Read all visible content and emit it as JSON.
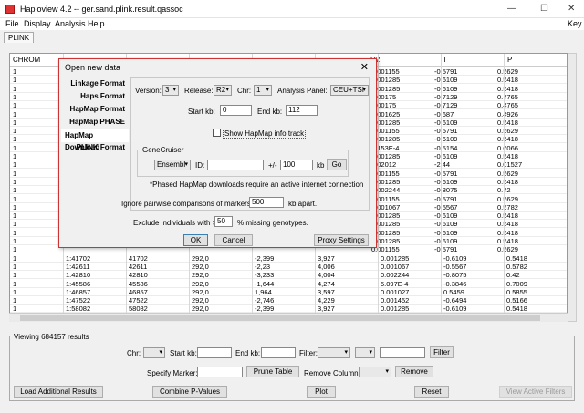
{
  "window": {
    "title": "Haploview 4.2 -- ger.sand.plink.result.qassoc",
    "controls": [
      "—",
      "☐",
      "✕"
    ]
  },
  "menu": [
    "File",
    "Display",
    "Analysis",
    "Help"
  ],
  "menu_right": "Key",
  "tab": "PLINK",
  "table": {
    "columns": [
      "CHROM",
      "",
      "",
      "",
      "",
      "R2",
      "T",
      "P"
    ],
    "rows": [
      [
        "1",
        "",
        "",
        "",
        "",
        "0.001155",
        "-0.5791",
        "0.5629"
      ],
      [
        "1",
        "",
        "",
        "",
        "",
        "0.001285",
        "-0.6109",
        "0.5418"
      ],
      [
        "1",
        "",
        "",
        "",
        "",
        "0.001285",
        "-0.6109",
        "0.5418"
      ],
      [
        "1",
        "",
        "",
        "",
        "",
        "0.00175",
        "-0.7129",
        "0.4765"
      ],
      [
        "1",
        "",
        "",
        "",
        "",
        "0.00175",
        "-0.7129",
        "0.4765"
      ],
      [
        "1",
        "",
        "",
        "",
        "",
        "0.001625",
        "-0.687",
        "0.4926"
      ],
      [
        "1",
        "",
        "",
        "",
        "",
        "0.001285",
        "-0.6109",
        "0.5418"
      ],
      [
        "1",
        "",
        "",
        "",
        "",
        "0.001155",
        "-0.5791",
        "0.5629"
      ],
      [
        "1",
        "",
        "",
        "",
        "",
        "0.001285",
        "-0.6109",
        "0.5418"
      ],
      [
        "1",
        "",
        "",
        "",
        "",
        "9.153E-4",
        "-0.5154",
        "0.6066"
      ],
      [
        "1",
        "",
        "",
        "",
        "",
        "0.001285",
        "-0.6109",
        "0.5418"
      ],
      [
        "1",
        "",
        "",
        "",
        "",
        "0.02012",
        "-2.44",
        "0.01527"
      ],
      [
        "1",
        "",
        "",
        "",
        "",
        "0.001155",
        "-0.5791",
        "0.5629"
      ],
      [
        "1",
        "",
        "",
        "",
        "",
        "0.001285",
        "-0.6109",
        "0.5418"
      ],
      [
        "1",
        "",
        "",
        "",
        "",
        "0.002244",
        "-0.8075",
        "0.42"
      ],
      [
        "1",
        "",
        "",
        "",
        "",
        "0.001155",
        "-0.5791",
        "0.5629"
      ],
      [
        "1",
        "",
        "",
        "",
        "",
        "0.001067",
        "-0.5567",
        "0.5782"
      ],
      [
        "1",
        "",
        "",
        "",
        "",
        "0.001285",
        "-0.6109",
        "0.5418"
      ],
      [
        "1",
        "",
        "",
        "",
        "",
        "0.001285",
        "-0.6109",
        "0.5418"
      ],
      [
        "1",
        "",
        "",
        "",
        "",
        "0.001285",
        "-0.6109",
        "0.5418"
      ],
      [
        "1",
        "",
        "",
        "",
        "",
        "0.001285",
        "-0.6109",
        "0.5418"
      ],
      [
        "1",
        "",
        "",
        "",
        "",
        "0.001155",
        "-0.5791",
        "0.5629"
      ],
      [
        "1",
        "1:41702",
        "41702",
        "292,0",
        "-2,399",
        "3,927",
        "0.001285",
        "-0.6109",
        "0.5418"
      ],
      [
        "1",
        "1:42611",
        "42611",
        "292,0",
        "-2,23",
        "4,006",
        "0.001067",
        "-0.5567",
        "0.5782"
      ],
      [
        "1",
        "1:42810",
        "42810",
        "292,0",
        "-3,233",
        "4,004",
        "0.002244",
        "-0.8075",
        "0.42"
      ],
      [
        "1",
        "1:45586",
        "45586",
        "292,0",
        "-1,644",
        "4,274",
        "5.097E-4",
        "-0.3846",
        "0.7009"
      ],
      [
        "1",
        "1:46857",
        "46857",
        "292,0",
        "1,964",
        "3,597",
        "0.001027",
        "0.5459",
        "0.5855"
      ],
      [
        "1",
        "1:47522",
        "47522",
        "292,0",
        "-2,746",
        "4,229",
        "0.001452",
        "-0.6494",
        "0.5166"
      ],
      [
        "1",
        "1:58082",
        "58082",
        "292,0",
        "-2,399",
        "3,927",
        "0.001285",
        "-0.6109",
        "0.5418"
      ],
      [
        "1",
        "1:58109",
        "58109",
        "292,0",
        "-2,399",
        "3,927",
        "0.001285",
        "-0.6109",
        "0.5418"
      ]
    ]
  },
  "dialog": {
    "title": "Open new data",
    "close": "✕",
    "formats": [
      "Linkage Format",
      "Haps Format",
      "HapMap Format",
      "HapMap PHASE",
      "HapMap Download",
      "PLINK Format"
    ],
    "selected_format": "HapMap Download",
    "version_label": "Version:",
    "version_value": "3",
    "release_label": "Release:",
    "release_value": "R2",
    "chr_label": "Chr:",
    "chr_value": "1",
    "panel_label": "Analysis Panel:",
    "panel_value": "CEU+TSI",
    "start_label": "Start kb:",
    "start_value": "0",
    "end_label": "End kb:",
    "end_value": "112",
    "show_info_label": "Show HapMap info track",
    "gene_group_label": "GeneCruiser",
    "ensembl_value": "Ensembl",
    "id_label": "ID:",
    "id_value": "",
    "plusminus_label": "+/-",
    "plusminus_value": "100",
    "kb_label": "kb",
    "go_label": "Go",
    "note": "*Phased HapMap downloads require an active internet connection",
    "ignore_label": "Ignore pairwise comparisons of markers >",
    "ignore_value": "500",
    "ignore_unit": "kb apart.",
    "exclude_label": "Exclude individuals with >",
    "exclude_value": "50",
    "exclude_unit": "% missing genotypes.",
    "ok_label": "OK",
    "cancel_label": "Cancel",
    "proxy_label": "Proxy Settings"
  },
  "bottom": {
    "viewing": "Viewing 684157 results",
    "chr_label": "Chr:",
    "start_label": "Start kb:",
    "end_label": "End kb:",
    "filter_label": "Filter:",
    "filter_button": "Filter",
    "marker_label": "Specify Marker:",
    "prune_button": "Prune Table",
    "remove_col_label": "Remove Column:",
    "remove_button": "Remove",
    "load_button": "Load Additional Results",
    "combine_button": "Combine P-Values",
    "plot_button": "Plot",
    "reset_button": "Reset",
    "view_filters_button": "View Active Filters"
  }
}
